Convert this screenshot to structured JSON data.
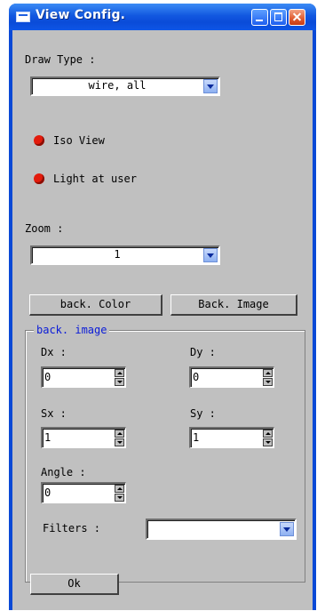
{
  "window": {
    "title": "View Config."
  },
  "draw_type": {
    "label": "Draw Type :",
    "selected": "wire, all"
  },
  "options": {
    "iso_view": {
      "label": "Iso View",
      "checked": true
    },
    "light_at_user": {
      "label": "Light at user",
      "checked": true
    }
  },
  "zoom": {
    "label": "Zoom :",
    "selected": "1"
  },
  "buttons": {
    "back_color": "back. Color",
    "back_image": "Back. Image",
    "ok": "Ok"
  },
  "back_image_group": {
    "title": "back. image",
    "dx": {
      "label": "Dx :",
      "value": "0"
    },
    "dy": {
      "label": "Dy :",
      "value": "0"
    },
    "sx": {
      "label": "Sx :",
      "value": "1"
    },
    "sy": {
      "label": "Sy :",
      "value": "1"
    },
    "angle": {
      "label": "Angle :",
      "value": "0"
    },
    "filters": {
      "label": "Filters :",
      "selected": ""
    }
  },
  "colors": {
    "title_bar": "#0a49d6",
    "client_bg": "#c0c0c0",
    "group_title": "#0a1bd8",
    "radio": "#e31b0c"
  }
}
